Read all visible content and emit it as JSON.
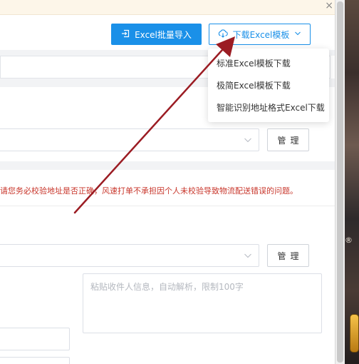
{
  "window": {
    "close_symbol": "×"
  },
  "toolbar": {
    "import_button": "Excel批量导入",
    "template_button": "下载Excel模板"
  },
  "template_menu": {
    "items": [
      {
        "label": "标准Excel模板下载"
      },
      {
        "label": "极简Excel模板下载"
      },
      {
        "label": "智能识别地址格式Excel下载"
      }
    ]
  },
  "form": {
    "manage_button_1": "管理",
    "manage_button_2": "管理",
    "warning_text": "请您务必校验地址是否正确，风速打单不承担因个人未校验导致物流配送错误的问题。",
    "paste_placeholder": "粘贴收件人信息，自动解析，限制100字"
  },
  "desktop": {
    "partial_glyph": "®"
  },
  "colors": {
    "primary": "#1a90e8",
    "warning": "#c8362b",
    "annotation_arrow": "#9b1c23"
  },
  "icons": {
    "import": "import-icon",
    "download": "cloud-download-icon",
    "dropdown": "chevron-down-icon"
  }
}
